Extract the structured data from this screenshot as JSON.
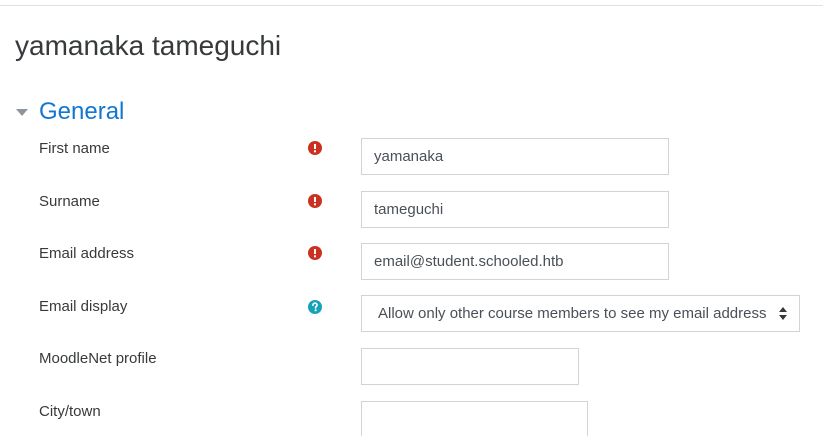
{
  "header": {
    "title": "yamanaka tameguchi"
  },
  "section": {
    "title": "General"
  },
  "fields": {
    "first_name": {
      "label": "First name",
      "value": "yamanaka",
      "status_icon": "required-icon"
    },
    "surname": {
      "label": "Surname",
      "value": "tameguchi",
      "status_icon": "required-icon"
    },
    "email": {
      "label": "Email address",
      "value": "email@student.schooled.htb",
      "status_icon": "required-icon"
    },
    "email_display": {
      "label": "Email display",
      "selected": "Allow only other course members to see my email address",
      "status_icon": "help-icon"
    },
    "moodlenet": {
      "label": "MoodleNet profile",
      "value": ""
    },
    "city": {
      "label": "City/town",
      "value": ""
    }
  },
  "colors": {
    "accent": "#1177d1",
    "required": "#ca3120",
    "help": "#17a2b8",
    "text": "#373a3c",
    "border": "#ced4da"
  }
}
